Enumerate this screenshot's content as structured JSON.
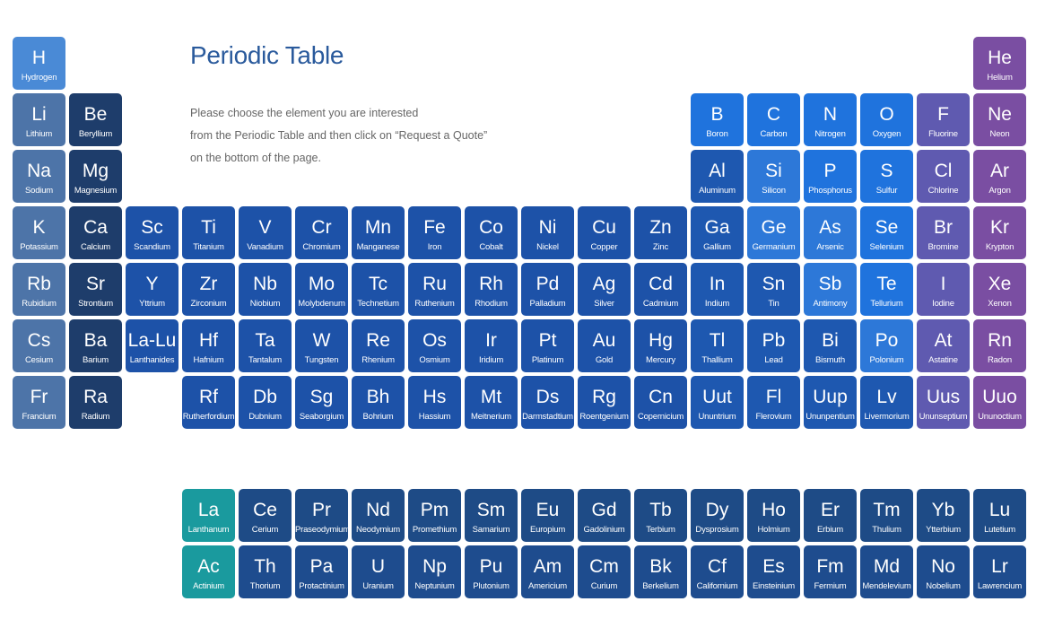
{
  "page": {
    "title": "Periodic Table",
    "intro": [
      "Please choose the element you are interested",
      "from the Periodic Table and then click on “Request a Quote”",
      "on the bottom of the page."
    ]
  },
  "colors": {
    "hydrogen": "#4a8ad6",
    "alkali": "#4d74a8",
    "alkaline": "#1e3d6b",
    "transition": "#1d52a8",
    "post_transition": "#1e58b0",
    "metalloid": "#2d78d8",
    "nonmetal": "#1f73dd",
    "halogen": "#5f5ab0",
    "noble": "#7a4ea2",
    "lanthanide_start": "#1a9a9e",
    "lanthanide": "#1e4b86",
    "actinide": "#1e4c8e"
  },
  "elements": [
    {
      "symbol": "H",
      "name": "Hydrogen",
      "row": 1,
      "col": 1,
      "group": "hydrogen"
    },
    {
      "symbol": "He",
      "name": "Helium",
      "row": 1,
      "col": 18,
      "group": "noble"
    },
    {
      "symbol": "Li",
      "name": "Lithium",
      "row": 2,
      "col": 1,
      "group": "alkali"
    },
    {
      "symbol": "Be",
      "name": "Beryllium",
      "row": 2,
      "col": 2,
      "group": "alkaline"
    },
    {
      "symbol": "B",
      "name": "Boron",
      "row": 2,
      "col": 13,
      "group": "nonmetal"
    },
    {
      "symbol": "C",
      "name": "Carbon",
      "row": 2,
      "col": 14,
      "group": "nonmetal"
    },
    {
      "symbol": "N",
      "name": "Nitrogen",
      "row": 2,
      "col": 15,
      "group": "nonmetal"
    },
    {
      "symbol": "O",
      "name": "Oxygen",
      "row": 2,
      "col": 16,
      "group": "nonmetal"
    },
    {
      "symbol": "F",
      "name": "Fluorine",
      "row": 2,
      "col": 17,
      "group": "halogen"
    },
    {
      "symbol": "Ne",
      "name": "Neon",
      "row": 2,
      "col": 18,
      "group": "noble"
    },
    {
      "symbol": "Na",
      "name": "Sodium",
      "row": 3,
      "col": 1,
      "group": "alkali"
    },
    {
      "symbol": "Mg",
      "name": "Magnesium",
      "row": 3,
      "col": 2,
      "group": "alkaline"
    },
    {
      "symbol": "Al",
      "name": "Aluminum",
      "row": 3,
      "col": 13,
      "group": "post_transition"
    },
    {
      "symbol": "Si",
      "name": "Silicon",
      "row": 3,
      "col": 14,
      "group": "metalloid"
    },
    {
      "symbol": "P",
      "name": "Phosphorus",
      "row": 3,
      "col": 15,
      "group": "nonmetal"
    },
    {
      "symbol": "S",
      "name": "Sulfur",
      "row": 3,
      "col": 16,
      "group": "nonmetal"
    },
    {
      "symbol": "Cl",
      "name": "Chlorine",
      "row": 3,
      "col": 17,
      "group": "halogen"
    },
    {
      "symbol": "Ar",
      "name": "Argon",
      "row": 3,
      "col": 18,
      "group": "noble"
    },
    {
      "symbol": "K",
      "name": "Potassium",
      "row": 4,
      "col": 1,
      "group": "alkali"
    },
    {
      "symbol": "Ca",
      "name": "Calcium",
      "row": 4,
      "col": 2,
      "group": "alkaline"
    },
    {
      "symbol": "Sc",
      "name": "Scandium",
      "row": 4,
      "col": 3,
      "group": "transition"
    },
    {
      "symbol": "Ti",
      "name": "Titanium",
      "row": 4,
      "col": 4,
      "group": "transition"
    },
    {
      "symbol": "V",
      "name": "Vanadium",
      "row": 4,
      "col": 5,
      "group": "transition"
    },
    {
      "symbol": "Cr",
      "name": "Chromium",
      "row": 4,
      "col": 6,
      "group": "transition"
    },
    {
      "symbol": "Mn",
      "name": "Manganese",
      "row": 4,
      "col": 7,
      "group": "transition"
    },
    {
      "symbol": "Fe",
      "name": "Iron",
      "row": 4,
      "col": 8,
      "group": "transition"
    },
    {
      "symbol": "Co",
      "name": "Cobalt",
      "row": 4,
      "col": 9,
      "group": "transition"
    },
    {
      "symbol": "Ni",
      "name": "Nickel",
      "row": 4,
      "col": 10,
      "group": "transition"
    },
    {
      "symbol": "Cu",
      "name": "Copper",
      "row": 4,
      "col": 11,
      "group": "transition"
    },
    {
      "symbol": "Zn",
      "name": "Zinc",
      "row": 4,
      "col": 12,
      "group": "transition"
    },
    {
      "symbol": "Ga",
      "name": "Gallium",
      "row": 4,
      "col": 13,
      "group": "post_transition"
    },
    {
      "symbol": "Ge",
      "name": "Germanium",
      "row": 4,
      "col": 14,
      "group": "metalloid"
    },
    {
      "symbol": "As",
      "name": "Arsenic",
      "row": 4,
      "col": 15,
      "group": "metalloid"
    },
    {
      "symbol": "Se",
      "name": "Selenium",
      "row": 4,
      "col": 16,
      "group": "nonmetal"
    },
    {
      "symbol": "Br",
      "name": "Bromine",
      "row": 4,
      "col": 17,
      "group": "halogen"
    },
    {
      "symbol": "Kr",
      "name": "Krypton",
      "row": 4,
      "col": 18,
      "group": "noble"
    },
    {
      "symbol": "Rb",
      "name": "Rubidium",
      "row": 5,
      "col": 1,
      "group": "alkali"
    },
    {
      "symbol": "Sr",
      "name": "Strontium",
      "row": 5,
      "col": 2,
      "group": "alkaline"
    },
    {
      "symbol": "Y",
      "name": "Yttrium",
      "row": 5,
      "col": 3,
      "group": "transition"
    },
    {
      "symbol": "Zr",
      "name": "Zirconium",
      "row": 5,
      "col": 4,
      "group": "transition"
    },
    {
      "symbol": "Nb",
      "name": "Niobium",
      "row": 5,
      "col": 5,
      "group": "transition"
    },
    {
      "symbol": "Mo",
      "name": "Molybdenum",
      "row": 5,
      "col": 6,
      "group": "transition"
    },
    {
      "symbol": "Tc",
      "name": "Technetium",
      "row": 5,
      "col": 7,
      "group": "transition"
    },
    {
      "symbol": "Ru",
      "name": "Ruthenium",
      "row": 5,
      "col": 8,
      "group": "transition"
    },
    {
      "symbol": "Rh",
      "name": "Rhodium",
      "row": 5,
      "col": 9,
      "group": "transition"
    },
    {
      "symbol": "Pd",
      "name": "Palladium",
      "row": 5,
      "col": 10,
      "group": "transition"
    },
    {
      "symbol": "Ag",
      "name": "Silver",
      "row": 5,
      "col": 11,
      "group": "transition"
    },
    {
      "symbol": "Cd",
      "name": "Cadmium",
      "row": 5,
      "col": 12,
      "group": "transition"
    },
    {
      "symbol": "In",
      "name": "Indium",
      "row": 5,
      "col": 13,
      "group": "post_transition"
    },
    {
      "symbol": "Sn",
      "name": "Tin",
      "row": 5,
      "col": 14,
      "group": "post_transition"
    },
    {
      "symbol": "Sb",
      "name": "Antimony",
      "row": 5,
      "col": 15,
      "group": "metalloid"
    },
    {
      "symbol": "Te",
      "name": "Tellurium",
      "row": 5,
      "col": 16,
      "group": "nonmetal"
    },
    {
      "symbol": "I",
      "name": "Iodine",
      "row": 5,
      "col": 17,
      "group": "halogen"
    },
    {
      "symbol": "Xe",
      "name": "Xenon",
      "row": 5,
      "col": 18,
      "group": "noble"
    },
    {
      "symbol": "Cs",
      "name": "Cesium",
      "row": 6,
      "col": 1,
      "group": "alkali"
    },
    {
      "symbol": "Ba",
      "name": "Barium",
      "row": 6,
      "col": 2,
      "group": "alkaline"
    },
    {
      "symbol": "La-Lu",
      "name": "Lanthanides",
      "row": 6,
      "col": 3,
      "group": "transition"
    },
    {
      "symbol": "Hf",
      "name": "Hafnium",
      "row": 6,
      "col": 4,
      "group": "transition"
    },
    {
      "symbol": "Ta",
      "name": "Tantalum",
      "row": 6,
      "col": 5,
      "group": "transition"
    },
    {
      "symbol": "W",
      "name": "Tungsten",
      "row": 6,
      "col": 6,
      "group": "transition"
    },
    {
      "symbol": "Re",
      "name": "Rhenium",
      "row": 6,
      "col": 7,
      "group": "transition"
    },
    {
      "symbol": "Os",
      "name": "Osmium",
      "row": 6,
      "col": 8,
      "group": "transition"
    },
    {
      "symbol": "Ir",
      "name": "Iridium",
      "row": 6,
      "col": 9,
      "group": "transition"
    },
    {
      "symbol": "Pt",
      "name": "Platinum",
      "row": 6,
      "col": 10,
      "group": "transition"
    },
    {
      "symbol": "Au",
      "name": "Gold",
      "row": 6,
      "col": 11,
      "group": "transition"
    },
    {
      "symbol": "Hg",
      "name": "Mercury",
      "row": 6,
      "col": 12,
      "group": "transition"
    },
    {
      "symbol": "Tl",
      "name": "Thallium",
      "row": 6,
      "col": 13,
      "group": "post_transition"
    },
    {
      "symbol": "Pb",
      "name": "Lead",
      "row": 6,
      "col": 14,
      "group": "post_transition"
    },
    {
      "symbol": "Bi",
      "name": "Bismuth",
      "row": 6,
      "col": 15,
      "group": "post_transition"
    },
    {
      "symbol": "Po",
      "name": "Polonium",
      "row": 6,
      "col": 16,
      "group": "metalloid"
    },
    {
      "symbol": "At",
      "name": "Astatine",
      "row": 6,
      "col": 17,
      "group": "halogen"
    },
    {
      "symbol": "Rn",
      "name": "Radon",
      "row": 6,
      "col": 18,
      "group": "noble"
    },
    {
      "symbol": "Fr",
      "name": "Francium",
      "row": 7,
      "col": 1,
      "group": "alkali"
    },
    {
      "symbol": "Ra",
      "name": "Radium",
      "row": 7,
      "col": 2,
      "group": "alkaline"
    },
    {
      "symbol": "Rf",
      "name": "Rutherfordium",
      "row": 7,
      "col": 4,
      "group": "transition"
    },
    {
      "symbol": "Db",
      "name": "Dubnium",
      "row": 7,
      "col": 5,
      "group": "transition"
    },
    {
      "symbol": "Sg",
      "name": "Seaborgium",
      "row": 7,
      "col": 6,
      "group": "transition"
    },
    {
      "symbol": "Bh",
      "name": "Bohrium",
      "row": 7,
      "col": 7,
      "group": "transition"
    },
    {
      "symbol": "Hs",
      "name": "Hassium",
      "row": 7,
      "col": 8,
      "group": "transition"
    },
    {
      "symbol": "Mt",
      "name": "Meitnerium",
      "row": 7,
      "col": 9,
      "group": "transition"
    },
    {
      "symbol": "Ds",
      "name": "Darmstadtium",
      "row": 7,
      "col": 10,
      "group": "transition"
    },
    {
      "symbol": "Rg",
      "name": "Roentgenium",
      "row": 7,
      "col": 11,
      "group": "transition"
    },
    {
      "symbol": "Cn",
      "name": "Copernicium",
      "row": 7,
      "col": 12,
      "group": "transition"
    },
    {
      "symbol": "Uut",
      "name": "Ununtrium",
      "row": 7,
      "col": 13,
      "group": "post_transition"
    },
    {
      "symbol": "Fl",
      "name": "Flerovium",
      "row": 7,
      "col": 14,
      "group": "post_transition"
    },
    {
      "symbol": "Uup",
      "name": "Ununpentium",
      "row": 7,
      "col": 15,
      "group": "post_transition"
    },
    {
      "symbol": "Lv",
      "name": "Livermorium",
      "row": 7,
      "col": 16,
      "group": "post_transition"
    },
    {
      "symbol": "Uus",
      "name": "Ununseptium",
      "row": 7,
      "col": 17,
      "group": "halogen"
    },
    {
      "symbol": "Uuo",
      "name": "Ununoctium",
      "row": 7,
      "col": 18,
      "group": "noble"
    },
    {
      "symbol": "La",
      "name": "Lanthanum",
      "row": 9,
      "col": 4,
      "group": "lanthanide_start"
    },
    {
      "symbol": "Ce",
      "name": "Cerium",
      "row": 9,
      "col": 5,
      "group": "lanthanide"
    },
    {
      "symbol": "Pr",
      "name": "Praseodymium",
      "row": 9,
      "col": 6,
      "group": "lanthanide"
    },
    {
      "symbol": "Nd",
      "name": "Neodymium",
      "row": 9,
      "col": 7,
      "group": "lanthanide"
    },
    {
      "symbol": "Pm",
      "name": "Promethium",
      "row": 9,
      "col": 8,
      "group": "lanthanide"
    },
    {
      "symbol": "Sm",
      "name": "Samarium",
      "row": 9,
      "col": 9,
      "group": "lanthanide"
    },
    {
      "symbol": "Eu",
      "name": "Europium",
      "row": 9,
      "col": 10,
      "group": "lanthanide"
    },
    {
      "symbol": "Gd",
      "name": "Gadolinium",
      "row": 9,
      "col": 11,
      "group": "lanthanide"
    },
    {
      "symbol": "Tb",
      "name": "Terbium",
      "row": 9,
      "col": 12,
      "group": "lanthanide"
    },
    {
      "symbol": "Dy",
      "name": "Dysprosium",
      "row": 9,
      "col": 13,
      "group": "lanthanide"
    },
    {
      "symbol": "Ho",
      "name": "Holmium",
      "row": 9,
      "col": 14,
      "group": "lanthanide"
    },
    {
      "symbol": "Er",
      "name": "Erbium",
      "row": 9,
      "col": 15,
      "group": "lanthanide"
    },
    {
      "symbol": "Tm",
      "name": "Thulium",
      "row": 9,
      "col": 16,
      "group": "lanthanide"
    },
    {
      "symbol": "Yb",
      "name": "Ytterbium",
      "row": 9,
      "col": 17,
      "group": "lanthanide"
    },
    {
      "symbol": "Lu",
      "name": "Lutetium",
      "row": 9,
      "col": 18,
      "group": "lanthanide"
    },
    {
      "symbol": "Ac",
      "name": "Actinium",
      "row": 10,
      "col": 4,
      "group": "lanthanide_start"
    },
    {
      "symbol": "Th",
      "name": "Thorium",
      "row": 10,
      "col": 5,
      "group": "actinide"
    },
    {
      "symbol": "Pa",
      "name": "Protactinium",
      "row": 10,
      "col": 6,
      "group": "actinide"
    },
    {
      "symbol": "U",
      "name": "Uranium",
      "row": 10,
      "col": 7,
      "group": "actinide"
    },
    {
      "symbol": "Np",
      "name": "Neptunium",
      "row": 10,
      "col": 8,
      "group": "actinide"
    },
    {
      "symbol": "Pu",
      "name": "Plutonium",
      "row": 10,
      "col": 9,
      "group": "actinide"
    },
    {
      "symbol": "Am",
      "name": "Americium",
      "row": 10,
      "col": 10,
      "group": "actinide"
    },
    {
      "symbol": "Cm",
      "name": "Curium",
      "row": 10,
      "col": 11,
      "group": "actinide"
    },
    {
      "symbol": "Bk",
      "name": "Berkelium",
      "row": 10,
      "col": 12,
      "group": "actinide"
    },
    {
      "symbol": "Cf",
      "name": "Californium",
      "row": 10,
      "col": 13,
      "group": "actinide"
    },
    {
      "symbol": "Es",
      "name": "Einsteinium",
      "row": 10,
      "col": 14,
      "group": "actinide"
    },
    {
      "symbol": "Fm",
      "name": "Fermium",
      "row": 10,
      "col": 15,
      "group": "actinide"
    },
    {
      "symbol": "Md",
      "name": "Mendelevium",
      "row": 10,
      "col": 16,
      "group": "actinide"
    },
    {
      "symbol": "No",
      "name": "Nobelium",
      "row": 10,
      "col": 17,
      "group": "actinide"
    },
    {
      "symbol": "Lr",
      "name": "Lawrencium",
      "row": 10,
      "col": 18,
      "group": "actinide"
    }
  ]
}
